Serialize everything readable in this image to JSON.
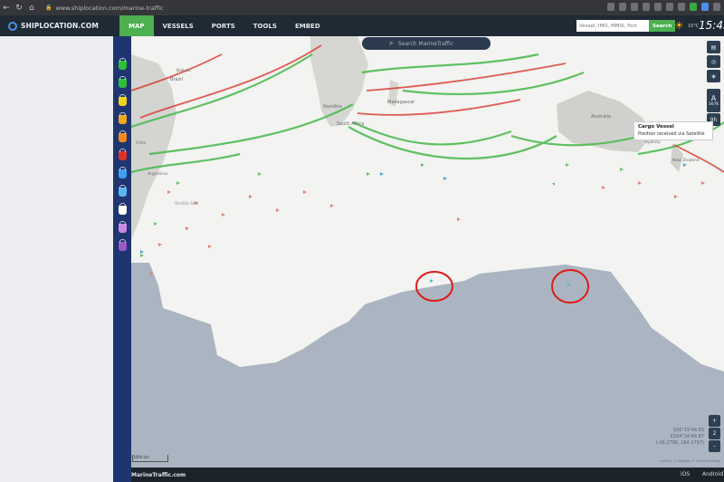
{
  "browser": {
    "url": "www.shiplocation.com/marine-traffic"
  },
  "site": {
    "logo": "SHIPLOCATION.COM",
    "nav": [
      "MAP",
      "VESSELS",
      "PORTS",
      "TOOLS",
      "EMBED"
    ],
    "search_placeholder": "Vessel, IMO, MMSI, Port",
    "search_button": "Search",
    "temperature": "15°C",
    "clock": "15:43"
  },
  "layers": {
    "bucket_colors": [
      "#2fbf3a",
      "#2fbf3a",
      "#f0d21e",
      "#f0a81e",
      "#f28a1e",
      "#e0312b",
      "#3ea0f0",
      "#58b6f2",
      "#ffffff",
      "#c88ae8",
      "#9a58c8"
    ]
  },
  "map": {
    "search_placeholder": "Search MarineTraffic",
    "labels": {
      "brazil": "Brazil",
      "namibia": "Namibia",
      "south_africa": "South Africa",
      "madagascar": "Madagascar",
      "australia": "Australia",
      "new_zealand": "New Zealand",
      "chile": "Chile",
      "argentina": "Argentina",
      "bolivia": "Bolivia",
      "scotia_sea": "Scotia Sea",
      "sydney": "Sydney"
    },
    "controls": {
      "layers_label": "A",
      "speed_label": "367K",
      "time_label": "9h",
      "zoom_in": "+",
      "zoom_level": "2",
      "zoom_out": "–"
    },
    "tooltip": {
      "title": "Cargo Vessel",
      "detail": "Position received via Satellite"
    },
    "coords": {
      "lat": "S56°15'46.83",
      "lon": "E164°16'46.87",
      "decimal": "(-56.2796, 164.1797)"
    },
    "attribution": "Leaflet | © Mapbox © OpenStreetMap",
    "scale": "1000 km"
  },
  "footer": {
    "brand": "MarineTraffic.com",
    "ios": "iOS",
    "android": "Android"
  }
}
